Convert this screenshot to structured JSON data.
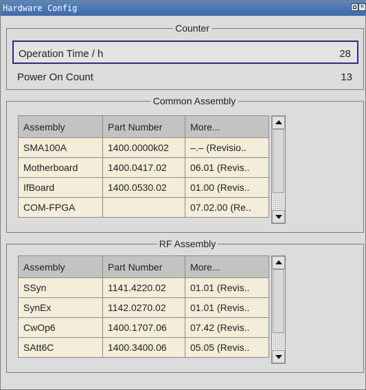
{
  "window": {
    "title": "Hardware Config"
  },
  "counter": {
    "label": "Counter",
    "operation_time": {
      "label": "Operation Time / h",
      "value": "28"
    },
    "power_on_count": {
      "label": "Power On Count",
      "value": "13"
    }
  },
  "common_assembly": {
    "label": "Common Assembly",
    "columns": [
      "Assembly",
      "Part Number",
      "More..."
    ],
    "rows": [
      [
        "SMA100A",
        "1400.0000k02",
        "–.– (Revisio.."
      ],
      [
        "Motherboard",
        "1400.0417.02",
        "06.01 (Revis.."
      ],
      [
        "IfBoard",
        "1400.0530.02",
        "01.00 (Revis.."
      ],
      [
        "COM-FPGA",
        "",
        "07.02.00 (Re.."
      ]
    ]
  },
  "rf_assembly": {
    "label": "RF Assembly",
    "columns": [
      "Assembly",
      "Part Number",
      "More..."
    ],
    "rows": [
      [
        "SSyn",
        "1141.4220.02",
        "01.01 (Revis.."
      ],
      [
        "SynEx",
        "1142.0270.02",
        "01.01 (Revis.."
      ],
      [
        "CwOp6",
        "1400.1707.06",
        "07.42 (Revis.."
      ],
      [
        "SAtt6C",
        "1400.3400.06",
        "05.05 (Revis.."
      ]
    ]
  },
  "icons": {
    "maximize": "maximize-icon",
    "close": "close-icon",
    "scroll_up": "arrow-up-icon",
    "scroll_down": "arrow-down-icon"
  }
}
